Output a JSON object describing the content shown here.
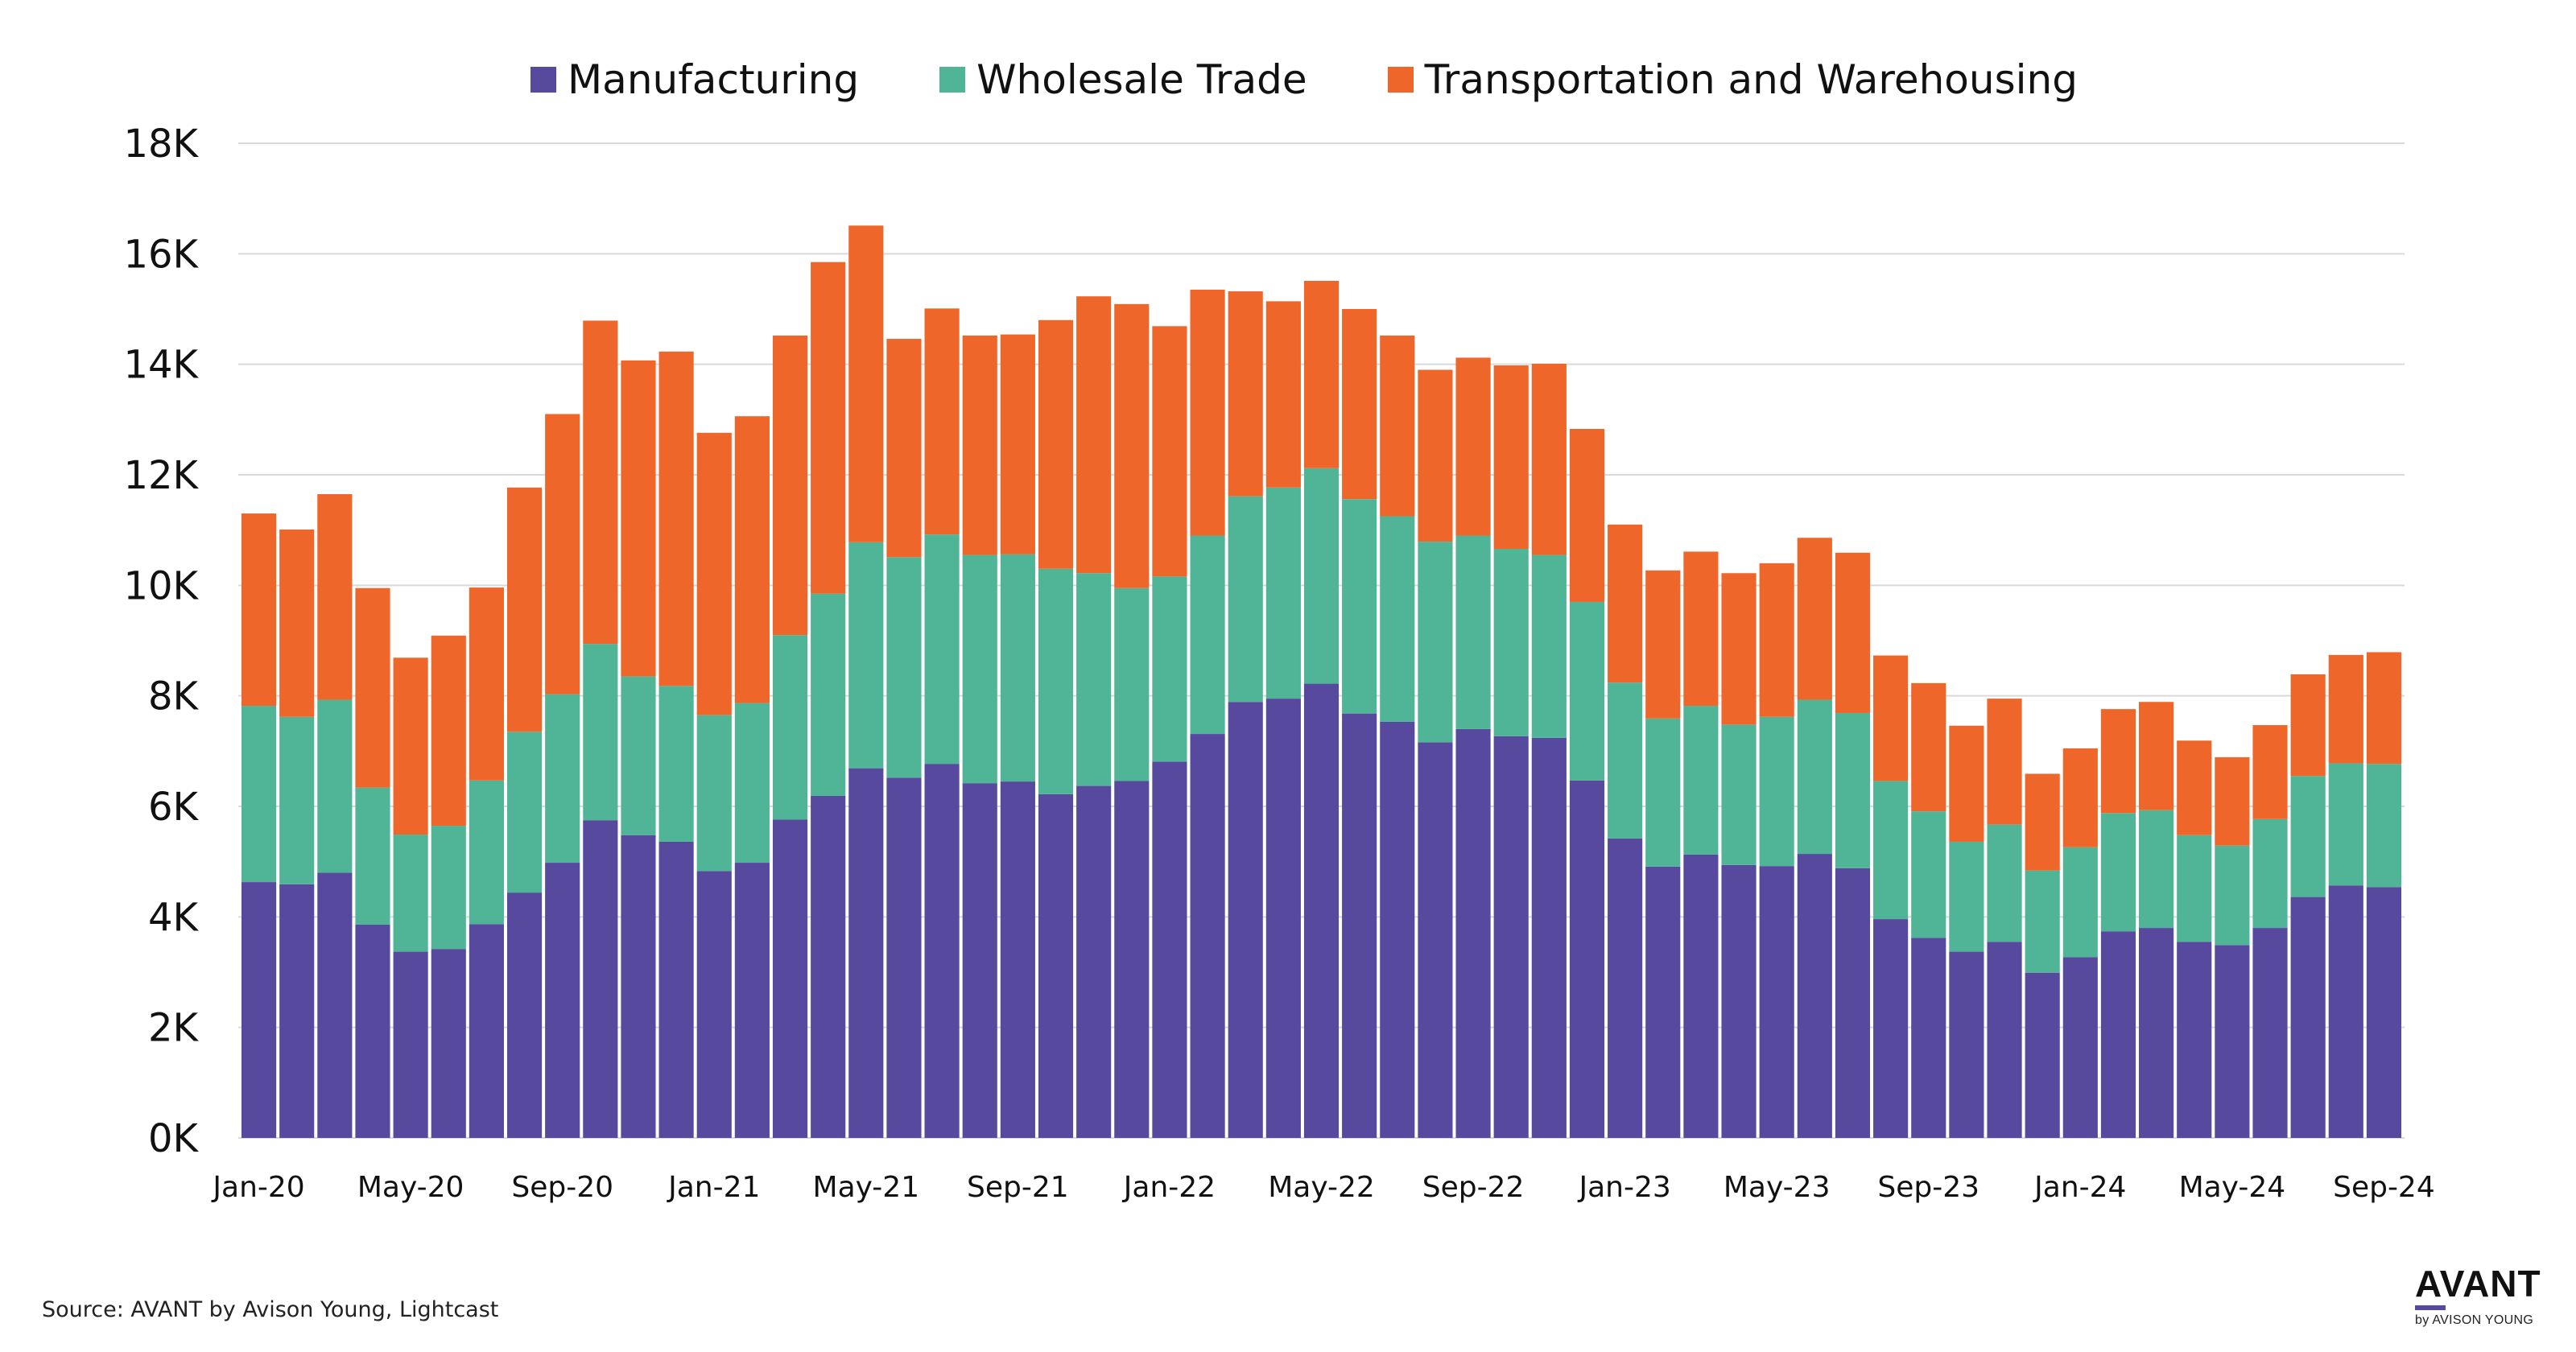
{
  "chart_data": {
    "type": "bar",
    "stacked": true,
    "title": "",
    "xlabel": "",
    "ylabel": "",
    "ylim": [
      0,
      18000
    ],
    "yticks": [
      0,
      2000,
      4000,
      6000,
      8000,
      10000,
      12000,
      14000,
      16000,
      18000
    ],
    "ytick_labels": [
      "0K",
      "2K",
      "4K",
      "6K",
      "8K",
      "10K",
      "12K",
      "14K",
      "16K",
      "18K"
    ],
    "grid": true,
    "legend_position": "top-center",
    "categories": [
      "Jan-20",
      "Feb-20",
      "Mar-20",
      "Apr-20",
      "May-20",
      "Jun-20",
      "Jul-20",
      "Aug-20",
      "Sep-20",
      "Oct-20",
      "Nov-20",
      "Dec-20",
      "Jan-21",
      "Feb-21",
      "Mar-21",
      "Apr-21",
      "May-21",
      "Jun-21",
      "Jul-21",
      "Aug-21",
      "Sep-21",
      "Oct-21",
      "Nov-21",
      "Dec-21",
      "Jan-22",
      "Feb-22",
      "Mar-22",
      "Apr-22",
      "May-22",
      "Jun-22",
      "Jul-22",
      "Aug-22",
      "Sep-22",
      "Oct-22",
      "Nov-22",
      "Dec-22",
      "Jan-23",
      "Feb-23",
      "Mar-23",
      "Apr-23",
      "May-23",
      "Jun-23",
      "Jul-23",
      "Aug-23",
      "Sep-23",
      "Oct-23",
      "Nov-23",
      "Dec-23",
      "Jan-24",
      "Feb-24",
      "Mar-24",
      "Apr-24",
      "May-24",
      "Jun-24",
      "Jul-24",
      "Aug-24",
      "Sep-24"
    ],
    "xtick_labels": [
      "Jan-20",
      "May-20",
      "Sep-20",
      "Jan-21",
      "May-21",
      "Sep-21",
      "Jan-22",
      "May-22",
      "Sep-22",
      "Jan-23",
      "May-23",
      "Sep-23",
      "Jan-24",
      "May-24",
      "Sep-24"
    ],
    "series": [
      {
        "name": "Manufacturing",
        "color": "#574A9E",
        "values": [
          4630,
          4590,
          4800,
          3860,
          3370,
          3420,
          3870,
          4440,
          4980,
          5750,
          5480,
          5360,
          4830,
          4980,
          5760,
          6190,
          6690,
          6520,
          6770,
          6420,
          6450,
          6220,
          6370,
          6460,
          6810,
          7310,
          7890,
          7950,
          8220,
          7680,
          7530,
          7160,
          7400,
          7270,
          7240,
          6470,
          5420,
          4910,
          5130,
          4940,
          4920,
          5140,
          4880,
          3960,
          3620,
          3370,
          3550,
          2990,
          3270,
          3740,
          3800,
          3550,
          3490,
          3800,
          4360,
          4570,
          4540
        ]
      },
      {
        "name": "Wholesale Trade",
        "color": "#4FB596",
        "values": [
          3190,
          3030,
          3130,
          2480,
          2120,
          2230,
          2600,
          2910,
          3050,
          3190,
          2870,
          2820,
          2820,
          2890,
          3340,
          3660,
          4090,
          3990,
          4150,
          4130,
          4110,
          4080,
          3850,
          3490,
          3350,
          3590,
          3720,
          3820,
          3900,
          3880,
          3720,
          3630,
          3500,
          3390,
          3310,
          3230,
          2820,
          2680,
          2690,
          2540,
          2700,
          2790,
          2810,
          2500,
          2290,
          1990,
          2120,
          1850,
          1990,
          2140,
          2130,
          1930,
          1800,
          1970,
          2190,
          2210,
          2230
        ]
      },
      {
        "name": "Transportation and Warehousing",
        "color": "#EE6629",
        "values": [
          3480,
          3390,
          3720,
          3610,
          3200,
          3440,
          3490,
          4420,
          5070,
          5850,
          5720,
          6050,
          5110,
          5190,
          5420,
          6000,
          5730,
          3950,
          4090,
          3970,
          3980,
          4500,
          5010,
          5140,
          4530,
          4450,
          3710,
          3370,
          3390,
          3440,
          3270,
          3110,
          3220,
          3320,
          3460,
          3130,
          2860,
          2680,
          2790,
          2740,
          2780,
          2930,
          2900,
          2270,
          2320,
          2100,
          2280,
          1750,
          1790,
          1880,
          1960,
          1710,
          1600,
          1700,
          1840,
          1960,
          2020
        ]
      }
    ]
  },
  "legend": {
    "items": [
      {
        "label": "Manufacturing",
        "color": "#574A9E"
      },
      {
        "label": "Wholesale Trade",
        "color": "#4FB596"
      },
      {
        "label": "Transportation and Warehousing",
        "color": "#EE6629"
      }
    ]
  },
  "footer": {
    "source": "Source: AVANT by Avison Young, Lightcast"
  },
  "logo": {
    "word": "AVANT",
    "sub": "by AVISON YOUNG",
    "accent": "#574A9E"
  }
}
